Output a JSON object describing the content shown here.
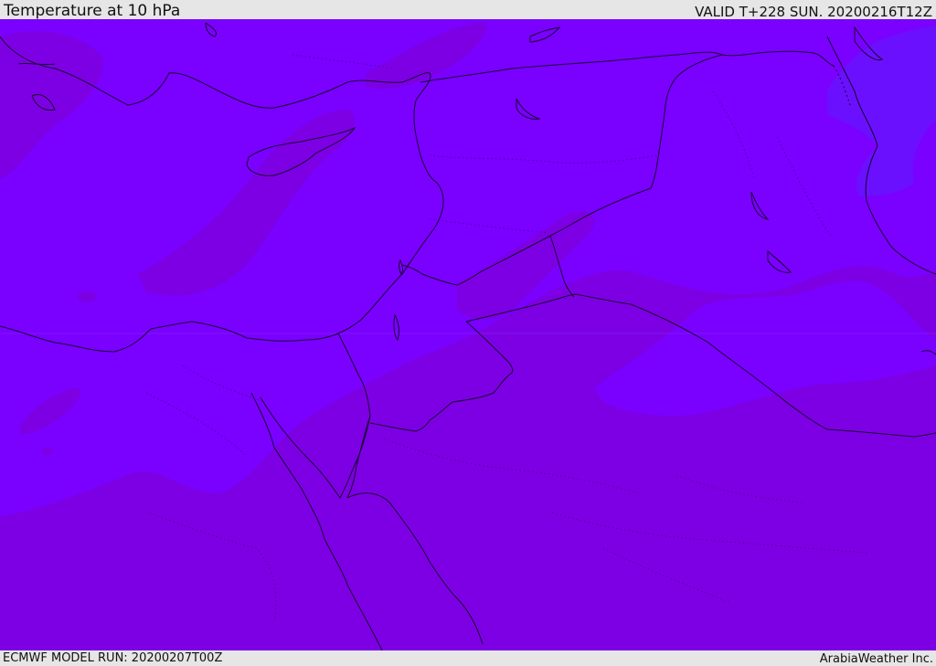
{
  "header": {
    "title": "Temperature at 10 hPa",
    "valid_time": "VALID T+228 SUN. 20200216T12Z"
  },
  "footer": {
    "model_run": "ECMWF MODEL RUN: 20200207T00Z",
    "credit": "ArabiaWeather Inc."
  },
  "map": {
    "region": "Eastern Mediterranean and Middle East",
    "colors": {
      "cold_band": "#7a00ff",
      "mid_band": "#7d00e4",
      "coolest_patch": "#6a10ff",
      "borders": "#1a0030"
    }
  }
}
